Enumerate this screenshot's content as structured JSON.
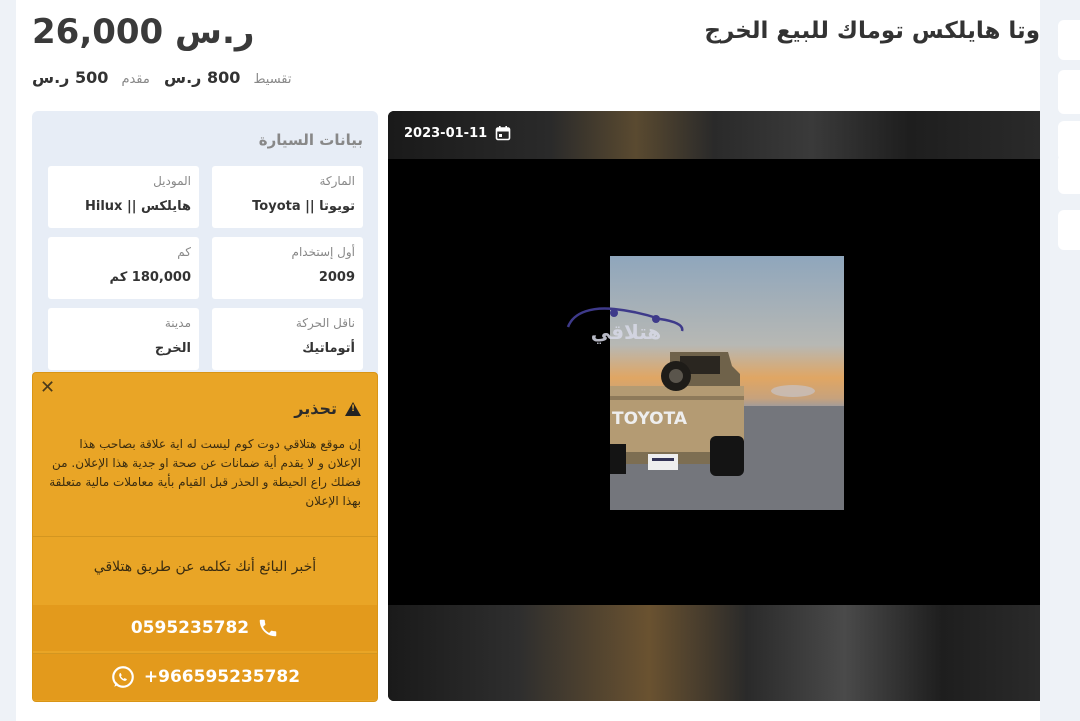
{
  "listing": {
    "title": "وتا هايلكس توماك للبيع الخرج",
    "price": "26,000 ر.س",
    "installment": {
      "label": "تقسيط",
      "value": "800 ر.س"
    },
    "down_payment": {
      "label": "مقدم",
      "value": "500 ر.س"
    }
  },
  "car_info": {
    "title": "بيانات السيارة",
    "fields": [
      {
        "key": "الماركة",
        "value": "تويوتا || Toyota"
      },
      {
        "key": "الموديل",
        "value": "هايلكس || Hilux"
      },
      {
        "key": "أول إستخدام",
        "value": "2009"
      },
      {
        "key": "كم",
        "value": "180,000 كم"
      },
      {
        "key": "ناقل الحركة",
        "value": "أتوماتيك"
      },
      {
        "key": "مدينة",
        "value": "الخرج"
      }
    ]
  },
  "warning": {
    "close": "✕",
    "title": "تحذير",
    "text": "إن موقع هتلاقي دوت كوم ليست له اية علاقة بصاحب هذا الإعلان و لا يقدم أية ضمانات عن صحة او جدية هذا الإعلان. من فضلك راع الحيطة و الحذر قبل القيام بأية معاملات مالية متعلقة بهذا الإعلان",
    "tell_seller": "أخبر البائع أنك تكلمه عن طريق هتلاقي",
    "phone": "0595235782",
    "whatsapp": "+966595235782"
  },
  "gallery": {
    "date": "2023-01-11",
    "watermark": "هتلاقي",
    "photo_text": "TOYOTA"
  },
  "icons": {
    "calendar": "calendar-icon",
    "phone": "phone-icon",
    "whatsapp": "whatsapp-icon",
    "warning": "warning-icon",
    "close": "close-icon"
  },
  "colors": {
    "warning_bg": "#e9a526",
    "button_bg": "#e39a1c",
    "panel_bg": "#e7edf6"
  }
}
